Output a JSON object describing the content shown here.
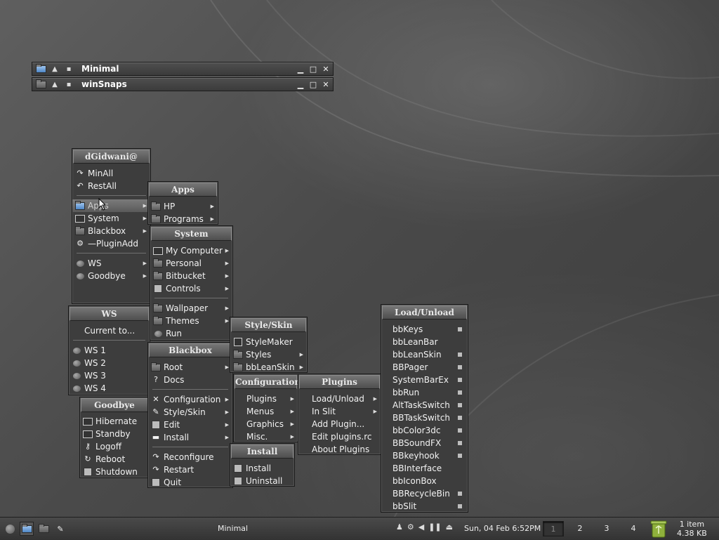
{
  "windows": [
    {
      "title": "Minimal"
    },
    {
      "title": "winSnaps"
    }
  ],
  "root_menu": {
    "title": "dGidwani@",
    "items": [
      {
        "label": "MinAll"
      },
      {
        "label": "RestAll"
      },
      {
        "label": "Apps"
      },
      {
        "label": "System"
      },
      {
        "label": "Blackbox"
      },
      {
        "label": "—PluginAdd"
      },
      {
        "label": "WS"
      },
      {
        "label": "Goodbye"
      }
    ]
  },
  "apps_menu": {
    "title": "Apps",
    "items": [
      {
        "label": "HP"
      },
      {
        "label": "Programs"
      }
    ]
  },
  "system_menu": {
    "title": "System",
    "items": [
      {
        "label": "My Computer"
      },
      {
        "label": "Personal"
      },
      {
        "label": "Bitbucket"
      },
      {
        "label": "Controls"
      },
      {
        "label": "Wallpaper"
      },
      {
        "label": "Themes"
      },
      {
        "label": "Run"
      }
    ]
  },
  "ws_menu": {
    "title": "WS",
    "items": [
      {
        "label": "Current to..."
      },
      {
        "label": "WS 1"
      },
      {
        "label": "WS 2"
      },
      {
        "label": "WS 3"
      },
      {
        "label": "WS 4"
      }
    ]
  },
  "goodbye_menu": {
    "title": "Goodbye",
    "items": [
      {
        "label": "Hibernate"
      },
      {
        "label": "Standby"
      },
      {
        "label": "Logoff"
      },
      {
        "label": "Reboot"
      },
      {
        "label": "Shutdown"
      }
    ]
  },
  "blackbox_menu": {
    "title": "Blackbox",
    "items": [
      {
        "label": "Root"
      },
      {
        "label": "Docs"
      },
      {
        "label": "Configuration"
      },
      {
        "label": "Style/Skin"
      },
      {
        "label": "Edit"
      },
      {
        "label": "Install"
      },
      {
        "label": "Reconfigure"
      },
      {
        "label": "Restart"
      },
      {
        "label": "Quit"
      }
    ]
  },
  "style_menu": {
    "title": "Style/Skin",
    "items": [
      {
        "label": "StyleMaker"
      },
      {
        "label": "Styles"
      },
      {
        "label": "bbLeanSkin"
      }
    ]
  },
  "config_menu": {
    "title": "Configuration",
    "items": [
      {
        "label": "Plugins"
      },
      {
        "label": "Menus"
      },
      {
        "label": "Graphics"
      },
      {
        "label": "Misc."
      }
    ]
  },
  "install_menu": {
    "title": "Install",
    "items": [
      {
        "label": "Install"
      },
      {
        "label": "Uninstall"
      }
    ]
  },
  "plugins_menu": {
    "title": "Plugins",
    "items": [
      {
        "label": "Load/Unload"
      },
      {
        "label": "In Slit"
      },
      {
        "label": "Add Plugin..."
      },
      {
        "label": "Edit plugins.rc"
      },
      {
        "label": "About Plugins"
      }
    ]
  },
  "load_menu": {
    "title": "Load/Unload",
    "items": [
      {
        "label": "bbKeys",
        "checked": true
      },
      {
        "label": "bbLeanBar",
        "checked": false
      },
      {
        "label": "bbLeanSkin",
        "checked": true
      },
      {
        "label": "BBPager",
        "checked": true
      },
      {
        "label": "SystemBarEx",
        "checked": true
      },
      {
        "label": "bbRun",
        "checked": true
      },
      {
        "label": "AltTaskSwitch",
        "checked": true
      },
      {
        "label": "BBTaskSwitch",
        "checked": true
      },
      {
        "label": "bbColor3dc",
        "checked": true
      },
      {
        "label": "BBSoundFX",
        "checked": true
      },
      {
        "label": "BBkeyhook",
        "checked": true
      },
      {
        "label": "BBInterface",
        "checked": false
      },
      {
        "label": "bbIconBox",
        "checked": false
      },
      {
        "label": "BBRecycleBin",
        "checked": true
      },
      {
        "label": "bbSlit",
        "checked": true
      }
    ]
  },
  "taskbar": {
    "task": "Minimal",
    "clock": "Sun, 04 Feb 6:52PM",
    "workspaces": [
      "1",
      "2",
      "3",
      "4"
    ],
    "recycle_line1": "1 item",
    "recycle_line2": "4.38 KB"
  }
}
